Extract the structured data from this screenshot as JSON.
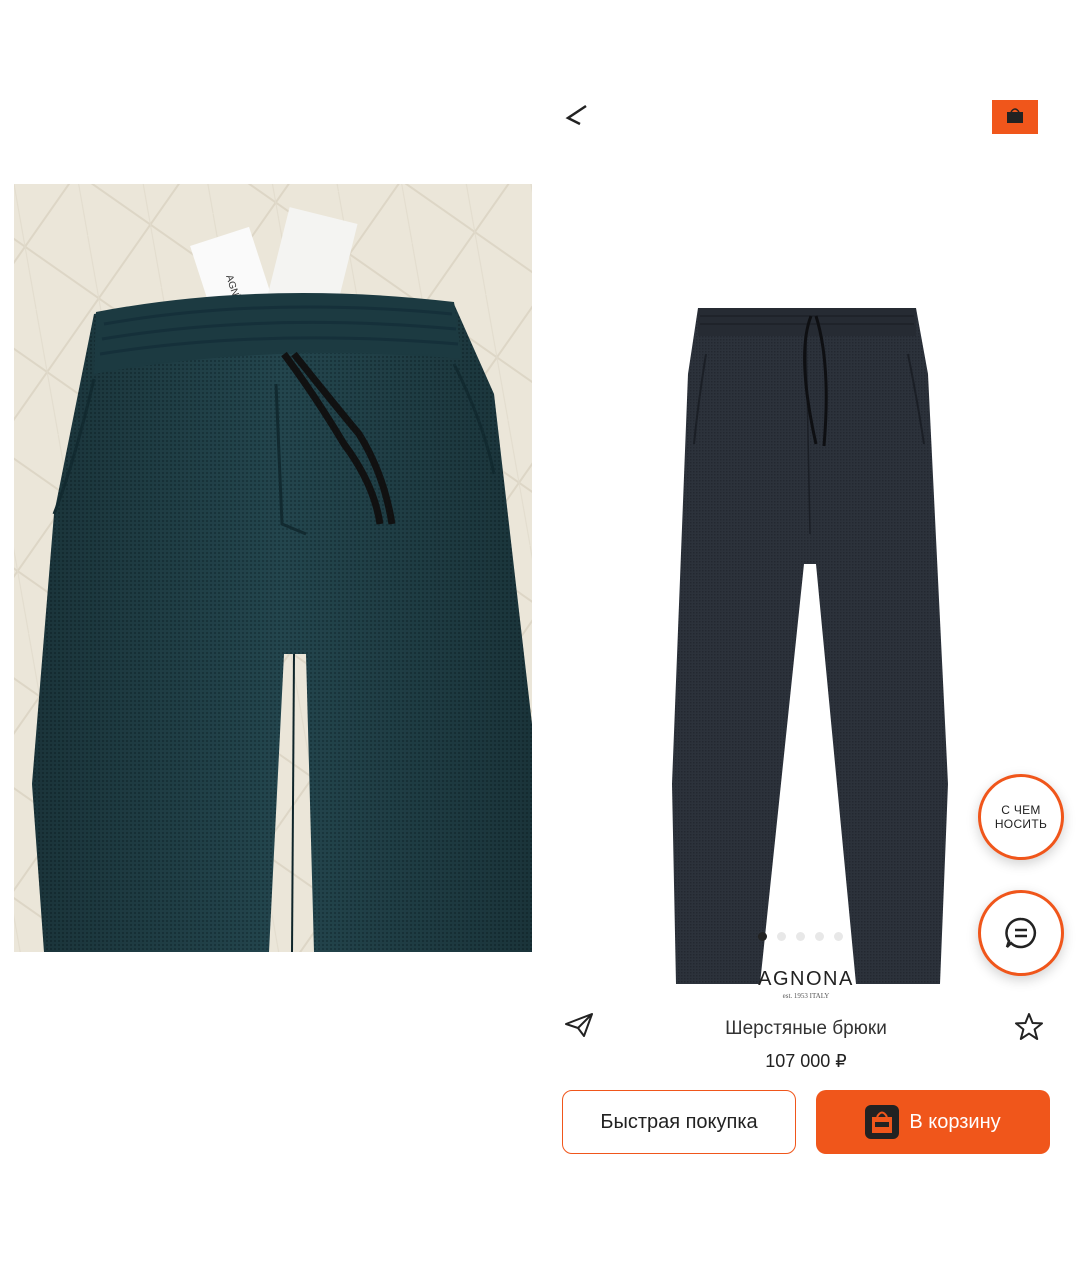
{
  "brand": {
    "name": "AGNONA",
    "tagline": "est. 1953 ITALY"
  },
  "product": {
    "title": "Шерстяные брюки",
    "price": "107 000 ₽",
    "images_count": 5,
    "active_image": 1
  },
  "actions": {
    "quick_buy": "Быстрая покупка",
    "add_to_cart": "В корзину",
    "outfit_line1": "С ЧЕМ",
    "outfit_line2": "НОСИТЬ"
  },
  "photo_tag": {
    "label": "AGNONA"
  },
  "icons": [
    "back-icon",
    "bag-icon",
    "share-icon",
    "star-icon",
    "chat-icon",
    "cart-icon"
  ],
  "colors": {
    "accent": "#f0561b",
    "text": "#222222",
    "pants_photo": "#1f4048",
    "pants_product": "#2a3038"
  }
}
